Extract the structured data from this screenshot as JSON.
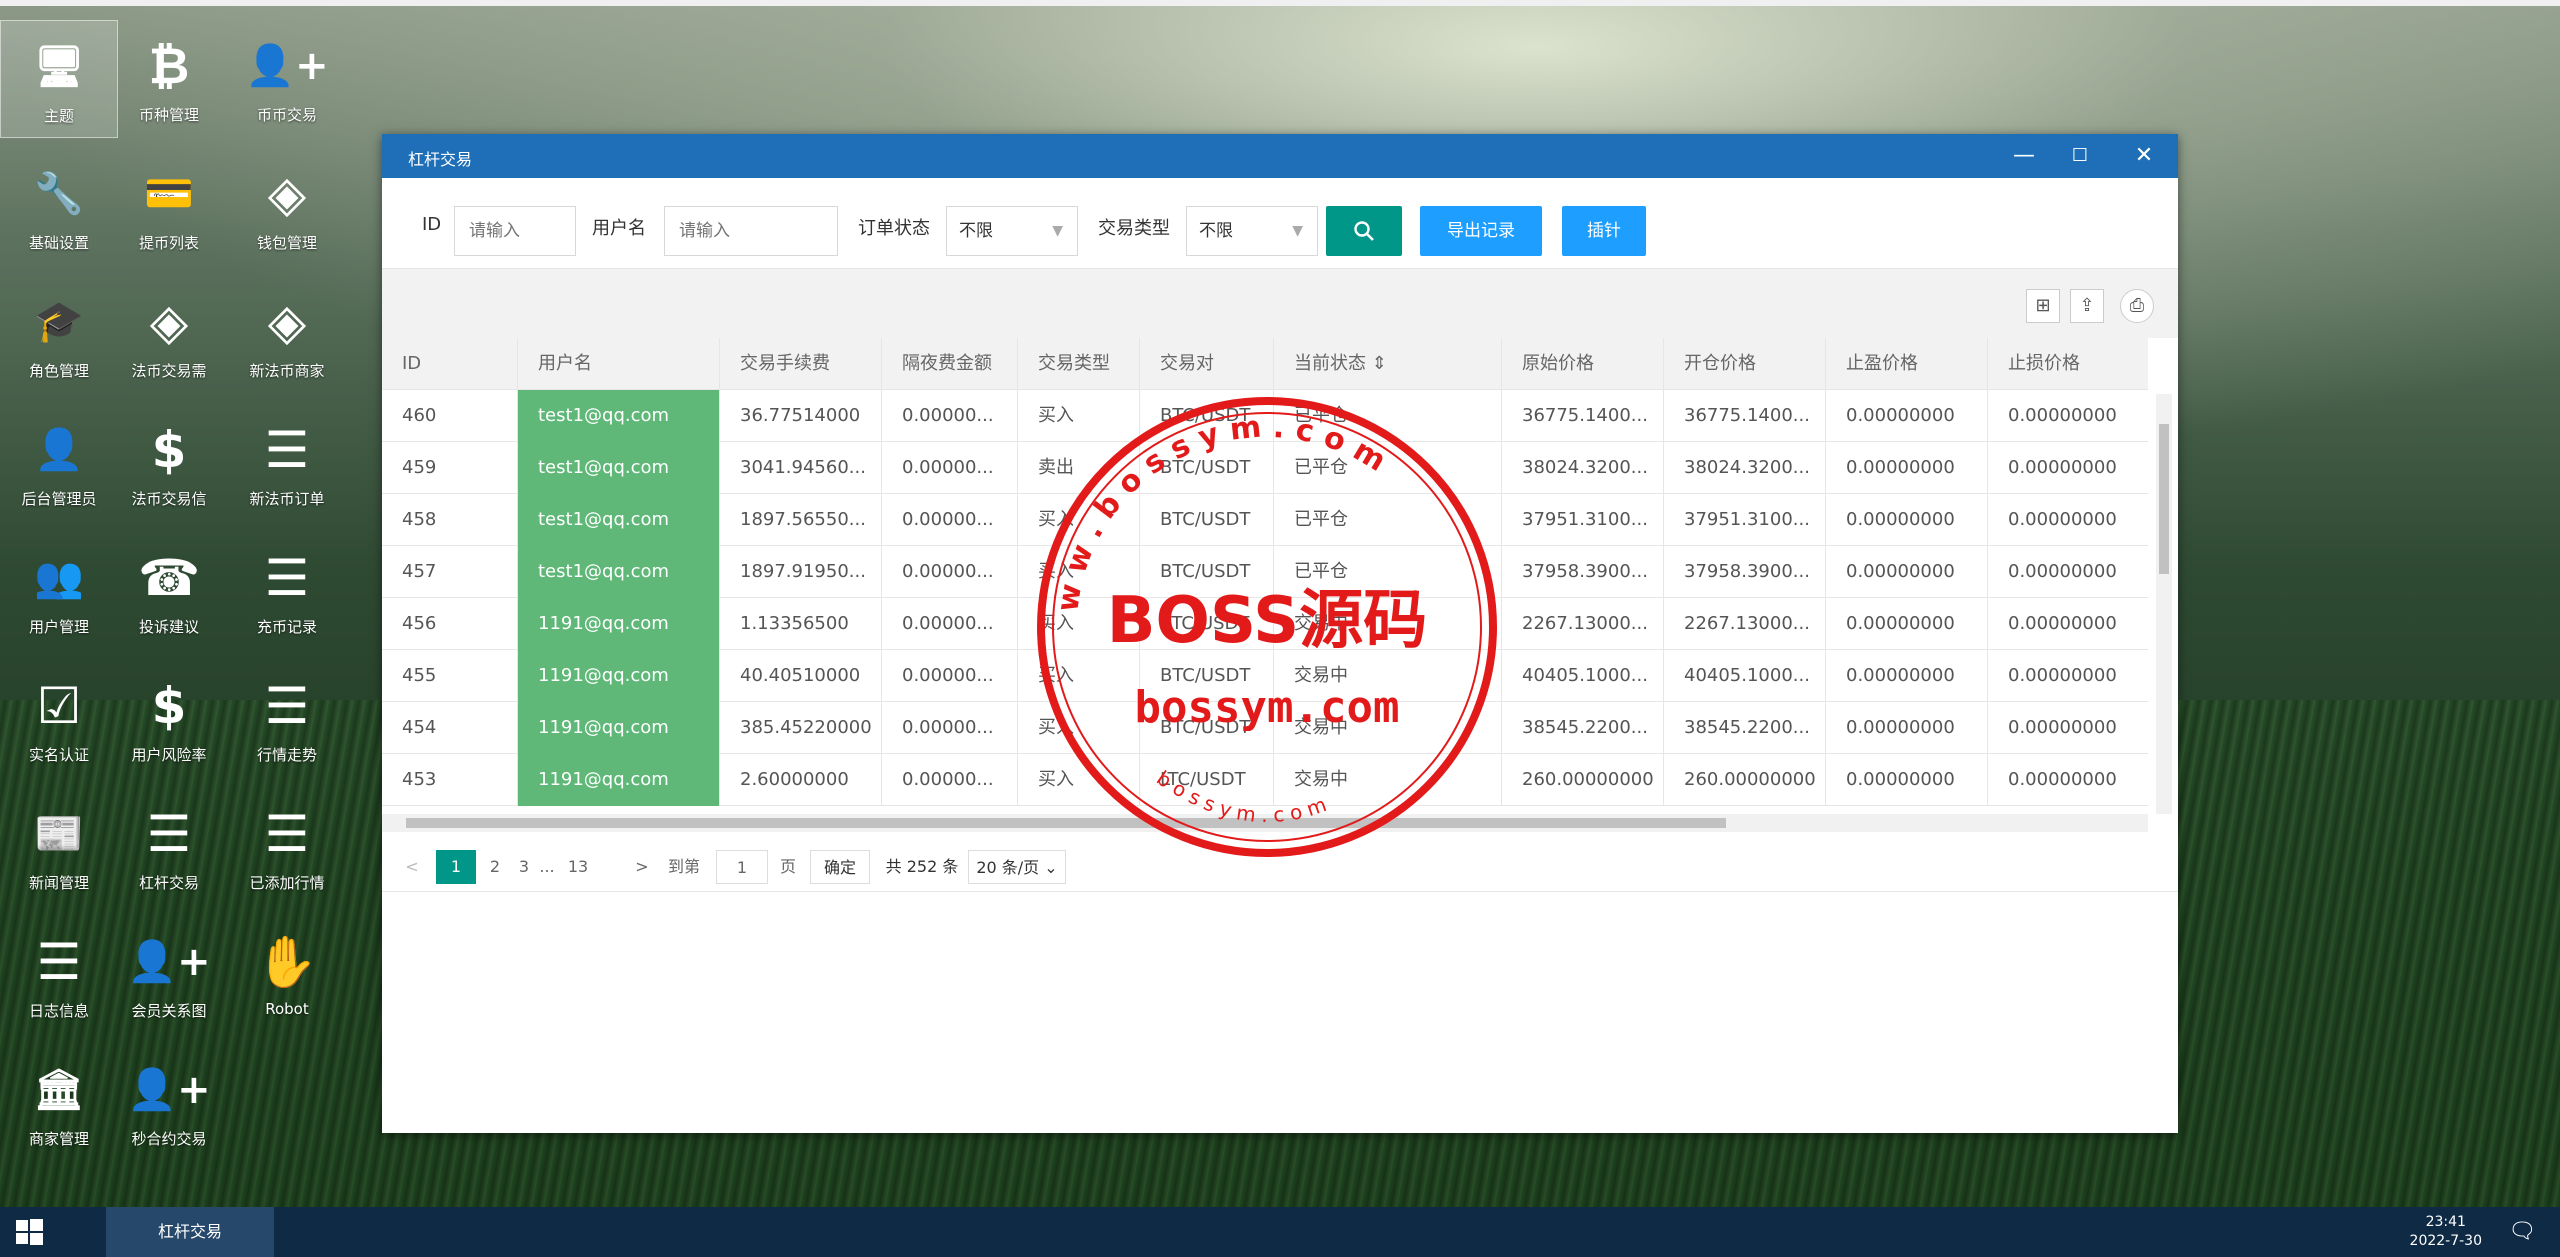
{
  "desktop": {
    "icons": [
      {
        "label": "主题",
        "glyph": "🖥"
      },
      {
        "label": "币种管理",
        "glyph": "₿"
      },
      {
        "label": "币币交易",
        "glyph": "👤+"
      },
      {
        "label": "基础设置",
        "glyph": "🔧"
      },
      {
        "label": "提币列表",
        "glyph": "💳"
      },
      {
        "label": "钱包管理",
        "glyph": "◈"
      },
      {
        "label": "角色管理",
        "glyph": "🎓"
      },
      {
        "label": "法币交易需",
        "glyph": "◈"
      },
      {
        "label": "新法币商家",
        "glyph": "◈"
      },
      {
        "label": "后台管理员",
        "glyph": "👤"
      },
      {
        "label": "法币交易信",
        "glyph": "$"
      },
      {
        "label": "新法币订单",
        "glyph": "☰"
      },
      {
        "label": "用户管理",
        "glyph": "👥"
      },
      {
        "label": "投诉建议",
        "glyph": "☎"
      },
      {
        "label": "充币记录",
        "glyph": "☰"
      },
      {
        "label": "实名认证",
        "glyph": "☑"
      },
      {
        "label": "用户风险率",
        "glyph": "$"
      },
      {
        "label": "行情走势",
        "glyph": "☰"
      },
      {
        "label": "新闻管理",
        "glyph": "📰"
      },
      {
        "label": "杠杆交易",
        "glyph": "☰"
      },
      {
        "label": "已添加行情",
        "glyph": "☰"
      },
      {
        "label": "日志信息",
        "glyph": "☰"
      },
      {
        "label": "会员关系图",
        "glyph": "👤+"
      },
      {
        "label": "Robot",
        "glyph": "✋"
      },
      {
        "label": "商家管理",
        "glyph": "🏛"
      },
      {
        "label": "秒合约交易",
        "glyph": "👤+"
      }
    ]
  },
  "window": {
    "title": "杠杆交易",
    "min": "—",
    "max": "☐",
    "close": "✕"
  },
  "filters": {
    "id_label": "ID",
    "id_placeholder": "请输入",
    "username_label": "用户名",
    "username_placeholder": "请输入",
    "order_status_label": "订单状态",
    "order_status_value": "不限",
    "trade_type_label": "交易类型",
    "trade_type_value": "不限",
    "export_label": "导出记录",
    "pin_label": "插针"
  },
  "table": {
    "columns": [
      "ID",
      "用户名",
      "交易手续费",
      "隔夜费金额",
      "交易类型",
      "交易对",
      "当前状态 ⇕",
      "原始价格",
      "开仓价格",
      "止盈价格",
      "止损价格"
    ],
    "rows": [
      [
        "460",
        "test1@qq.com",
        "36.77514000",
        "0.00000...",
        "买入",
        "BTC/USDT",
        "已平仓",
        "36775.1400...",
        "36775.1400...",
        "0.00000000",
        "0.00000000"
      ],
      [
        "459",
        "test1@qq.com",
        "3041.94560...",
        "0.00000...",
        "卖出",
        "BTC/USDT",
        "已平仓",
        "38024.3200...",
        "38024.3200...",
        "0.00000000",
        "0.00000000"
      ],
      [
        "458",
        "test1@qq.com",
        "1897.56550...",
        "0.00000...",
        "买入",
        "BTC/USDT",
        "已平仓",
        "37951.3100...",
        "37951.3100...",
        "0.00000000",
        "0.00000000"
      ],
      [
        "457",
        "test1@qq.com",
        "1897.91950...",
        "0.00000...",
        "买入",
        "BTC/USDT",
        "已平仓",
        "37958.3900...",
        "37958.3900...",
        "0.00000000",
        "0.00000000"
      ],
      [
        "456",
        "1191@qq.com",
        "1.13356500",
        "0.00000...",
        "买入",
        "ETC/USDT",
        "交易中",
        "2267.13000...",
        "2267.13000...",
        "0.00000000",
        "0.00000000"
      ],
      [
        "455",
        "1191@qq.com",
        "40.40510000",
        "0.00000...",
        "买入",
        "BTC/USDT",
        "交易中",
        "40405.1000...",
        "40405.1000...",
        "0.00000000",
        "0.00000000"
      ],
      [
        "454",
        "1191@qq.com",
        "385.45220000",
        "0.00000...",
        "买入",
        "BTC/USDT",
        "交易中",
        "38545.2200...",
        "38545.2200...",
        "0.00000000",
        "0.00000000"
      ],
      [
        "453",
        "1191@qq.com",
        "2.60000000",
        "0.00000...",
        "买入",
        "LTC/USDT",
        "交易中",
        "260.00000000",
        "260.00000000",
        "0.00000000",
        "0.00000000"
      ]
    ]
  },
  "pagination": {
    "prev": "<",
    "pages": [
      "1",
      "2",
      "3",
      "...",
      "13"
    ],
    "next": ">",
    "goto_label": "到第",
    "goto_value": "1",
    "page_unit": "页",
    "confirm": "确定",
    "total": "共 252 条",
    "per_page": "20 条/页 ⌄"
  },
  "stamp": {
    "center_text": "BOSS源码",
    "domain_text": "bossym.com",
    "ring_text": "w w w . b o s s y m . c o m",
    "bottom_text": "b o s s y m . c o m"
  },
  "taskbar": {
    "task_label": "杠杆交易",
    "time": "23:41",
    "date": "2022-7-30"
  }
}
